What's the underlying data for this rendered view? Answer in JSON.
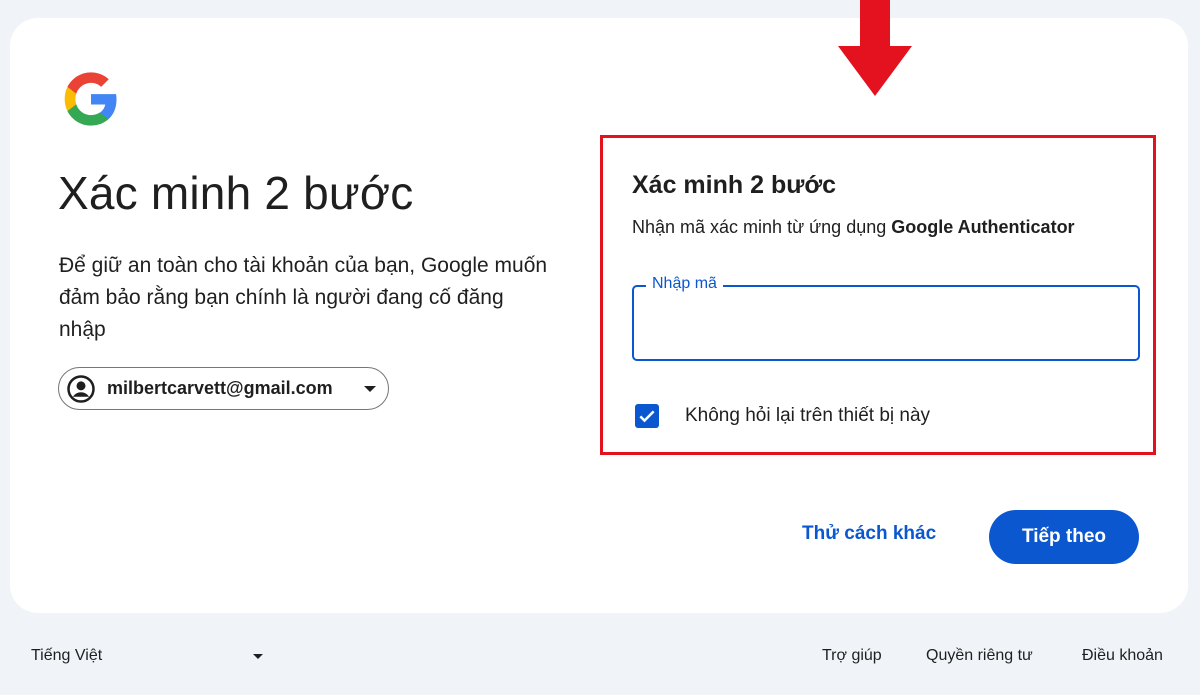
{
  "header": {
    "logo_icon": "google-g-logo"
  },
  "left": {
    "title": "Xác minh 2 bước",
    "description": "Để giữ an toàn cho tài khoản của bạn, Google muốn đảm bảo rằng bạn chính là người đang cố đăng nhập",
    "account_email": "milbertcarvett@gmail.com",
    "account_icon": "account-circle-icon"
  },
  "verification": {
    "title": "Xác minh 2 bước",
    "subtitle_prefix": "Nhận mã xác minh từ ứng dụng ",
    "subtitle_app": "Google Authenticator",
    "code_label": "Nhập mã",
    "code_value": "",
    "remember_label": "Không hỏi lại trên thiết bị này",
    "remember_checked": true
  },
  "annotation": {
    "highlight_color": "#e3121e",
    "arrow_icon": "down-arrow-icon"
  },
  "actions": {
    "try_another_label": "Thử cách khác",
    "next_label": "Tiếp theo"
  },
  "footer": {
    "language": "Tiếng Việt",
    "help_label": "Trợ giúp",
    "privacy_label": "Quyền riêng tư",
    "terms_label": "Điều khoản"
  },
  "colors": {
    "primary": "#0b57d0",
    "background": "#f0f4f9",
    "card": "#ffffff"
  }
}
